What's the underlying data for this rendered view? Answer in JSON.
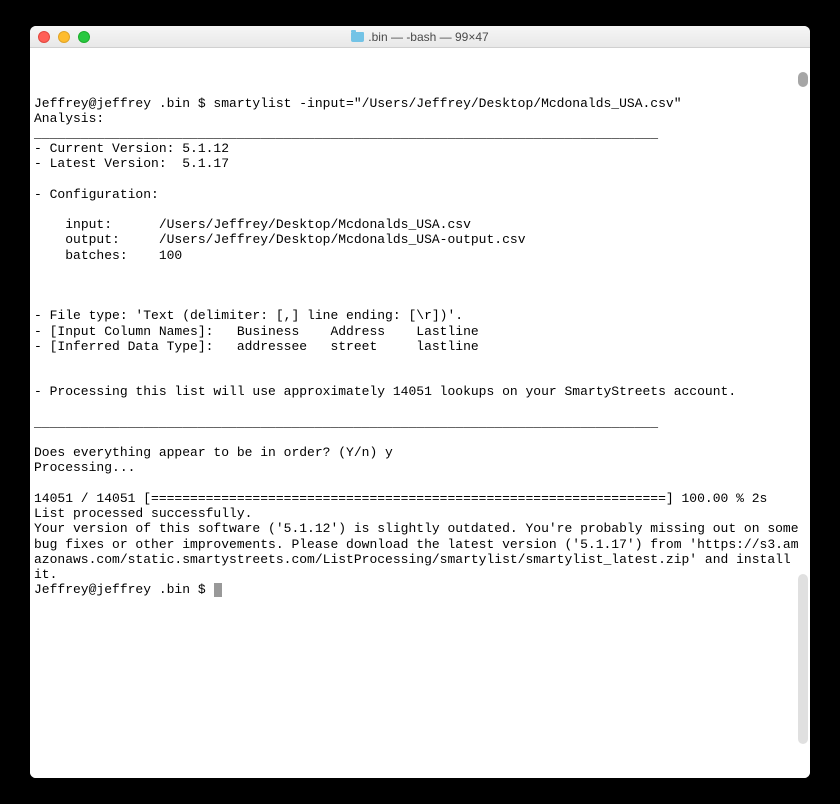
{
  "window": {
    "title": ".bin — -bash — 99×47"
  },
  "terminal": {
    "line01": "Jeffrey@jeffrey .bin $ smartylist -input=\"/Users/Jeffrey/Desktop/Mcdonalds_USA.csv\"",
    "line02": "Analysis:",
    "line03": "________________________________________________________________________________",
    "line04": "- Current Version: 5.1.12",
    "line05": "- Latest Version:  5.1.17",
    "line06": "",
    "line07": "- Configuration:",
    "line08": "",
    "line09": "    input:      /Users/Jeffrey/Desktop/Mcdonalds_USA.csv",
    "line10": "    output:     /Users/Jeffrey/Desktop/Mcdonalds_USA-output.csv",
    "line11": "    batches:    100",
    "line12": "",
    "line13": "",
    "line14": "",
    "line15": "- File type: 'Text (delimiter: [,] line ending: [\\r])'.",
    "line16": "- [Input Column Names]:   Business    Address    Lastline",
    "line17": "- [Inferred Data Type]:   addressee   street     lastline",
    "line18": "",
    "line19": "",
    "line20": "- Processing this list will use approximately 14051 lookups on your SmartyStreets account.",
    "line21": "",
    "line22": "________________________________________________________________________________",
    "line23": "",
    "line24": "Does everything appear to be in order? (Y/n) y",
    "line25": "Processing...",
    "line26": "",
    "line27": "14051 / 14051 [==================================================================] 100.00 % 2s",
    "line28": "List processed successfully.",
    "line29": "Your version of this software ('5.1.12') is slightly outdated. You're probably missing out on some bug fixes or other improvements. Please download the latest version ('5.1.17') from 'https://s3.amazonaws.com/static.smartystreets.com/ListProcessing/smartylist/smartylist_latest.zip' and install it.",
    "line30": "Jeffrey@jeffrey .bin $ "
  }
}
